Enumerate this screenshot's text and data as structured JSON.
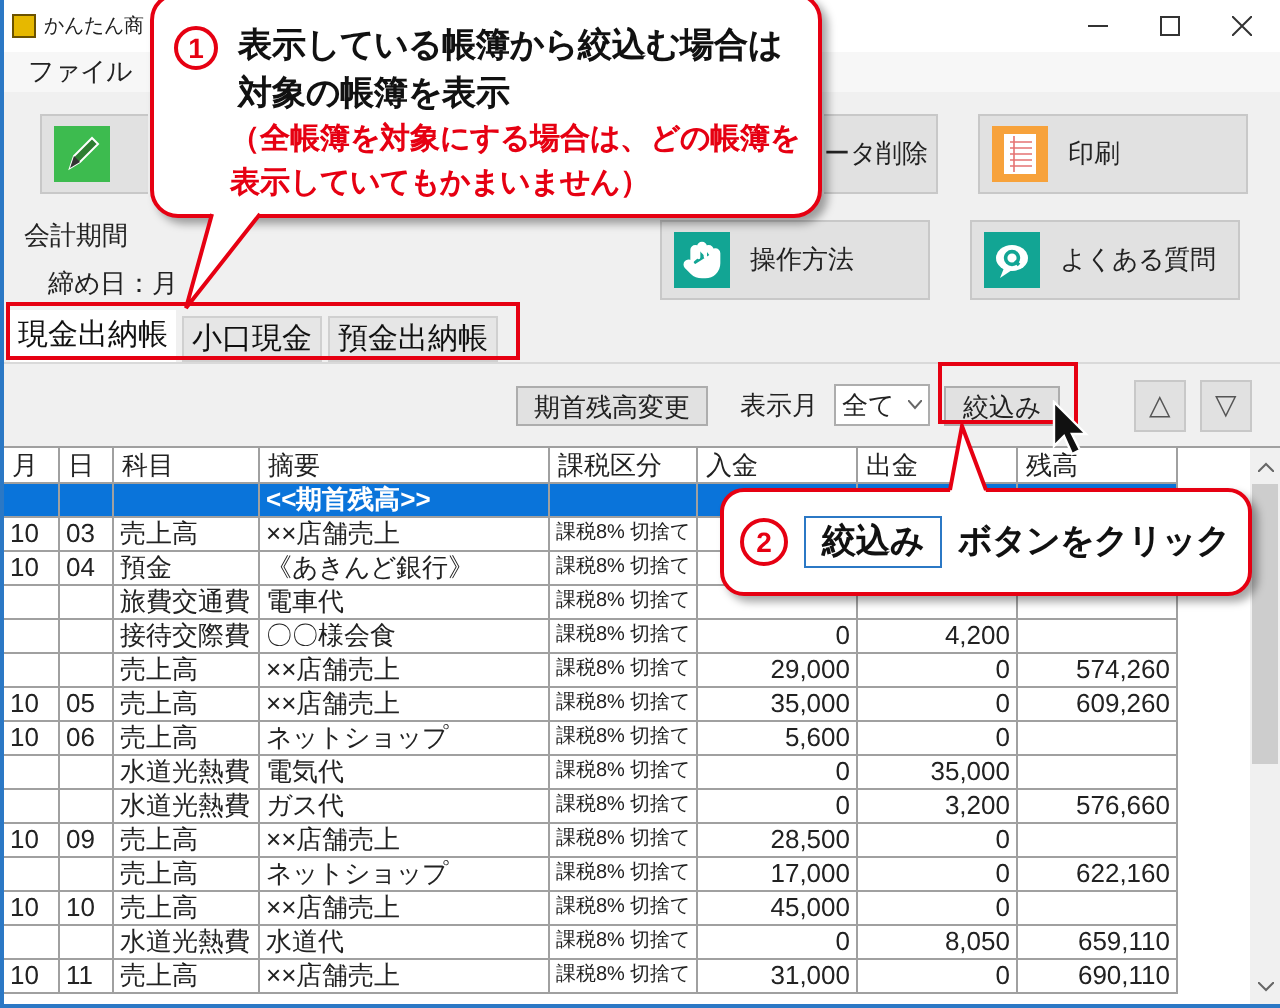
{
  "window": {
    "title": "かんたん商"
  },
  "menu": [
    "ファイル"
  ],
  "action_buttons": [
    {
      "kind": "edit"
    },
    {
      "kind": "delete",
      "label": "ータ削除"
    },
    {
      "kind": "print",
      "label": "印刷"
    },
    {
      "kind": "help",
      "label": "操作方法"
    },
    {
      "kind": "faq",
      "label": "よくある質問"
    }
  ],
  "period": {
    "label": "会計期間",
    "closing": "締め日：月"
  },
  "tabs": [
    {
      "label": "現金出納帳",
      "selected": true
    },
    {
      "label": "小口現金",
      "selected": false
    },
    {
      "label": "預金出納帳",
      "selected": false
    }
  ],
  "filter_bar": {
    "opening_balance_button": "期首残高変更",
    "month_label": "表示月",
    "month_value": "全て",
    "filter_button": "絞込み",
    "up": "△",
    "down": "▽"
  },
  "table": {
    "columns": [
      "月",
      "日",
      "科目",
      "摘要",
      "課税区分",
      "入金",
      "出金",
      "残高"
    ],
    "rows": [
      {
        "cells": [
          "",
          "",
          "",
          "<<期首残高>>",
          "",
          "",
          "",
          ""
        ],
        "selected": true
      },
      {
        "cells": [
          "10",
          "03",
          "売上高",
          "××店舗売上",
          "課税8% 切捨て",
          "",
          "",
          ""
        ],
        "selected": false
      },
      {
        "cells": [
          "10",
          "04",
          "預金",
          "《あきんど銀行》",
          "課税8% 切捨て",
          "",
          "",
          ""
        ],
        "selected": false
      },
      {
        "cells": [
          "",
          "",
          "旅費交通費",
          "電車代",
          "課税8% 切捨て",
          "",
          "",
          ""
        ],
        "selected": false
      },
      {
        "cells": [
          "",
          "",
          "接待交際費",
          "〇〇様会食",
          "課税8% 切捨て",
          "0",
          "4,200",
          ""
        ],
        "selected": false
      },
      {
        "cells": [
          "",
          "",
          "売上高",
          "××店舗売上",
          "課税8% 切捨て",
          "29,000",
          "0",
          "574,260"
        ],
        "selected": false
      },
      {
        "cells": [
          "10",
          "05",
          "売上高",
          "××店舗売上",
          "課税8% 切捨て",
          "35,000",
          "0",
          "609,260"
        ],
        "selected": false
      },
      {
        "cells": [
          "10",
          "06",
          "売上高",
          "ネットショップ",
          "課税8% 切捨て",
          "5,600",
          "0",
          ""
        ],
        "selected": false
      },
      {
        "cells": [
          "",
          "",
          "水道光熱費",
          "電気代",
          "課税8% 切捨て",
          "0",
          "35,000",
          ""
        ],
        "selected": false
      },
      {
        "cells": [
          "",
          "",
          "水道光熱費",
          "ガス代",
          "課税8% 切捨て",
          "0",
          "3,200",
          "576,660"
        ],
        "selected": false
      },
      {
        "cells": [
          "10",
          "09",
          "売上高",
          "××店舗売上",
          "課税8% 切捨て",
          "28,500",
          "0",
          ""
        ],
        "selected": false
      },
      {
        "cells": [
          "",
          "",
          "売上高",
          "ネットショップ",
          "課税8% 切捨て",
          "17,000",
          "0",
          "622,160"
        ],
        "selected": false
      },
      {
        "cells": [
          "10",
          "10",
          "売上高",
          "××店舗売上",
          "課税8% 切捨て",
          "45,000",
          "0",
          ""
        ],
        "selected": false
      },
      {
        "cells": [
          "",
          "",
          "水道光熱費",
          "水道代",
          "課税8% 切捨て",
          "0",
          "8,050",
          "659,110"
        ],
        "selected": false
      },
      {
        "cells": [
          "10",
          "11",
          "売上高",
          "××店舗売上",
          "課税8% 切捨て",
          "31,000",
          "0",
          "690,110"
        ],
        "selected": false
      }
    ]
  },
  "callouts": [
    {
      "number": "1",
      "lines": [
        "表示している帳簿から絞込む場合は",
        "対象の帳簿を表示"
      ],
      "notes": [
        "（全帳簿を対象にする場合は、どの帳簿を",
        "表示していてもかまいません）"
      ]
    },
    {
      "number": "2",
      "button_text": "絞込み",
      "text": "ボタンをクリック"
    }
  ]
}
